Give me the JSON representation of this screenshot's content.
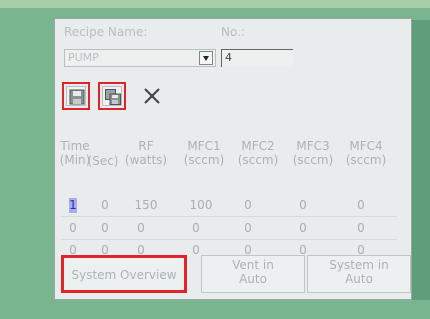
{
  "recipe": {
    "name_label": "Recipe Name:",
    "name_value": "PUMP",
    "no_label": "No.:",
    "no_value": "4"
  },
  "toolbar": {
    "save_icon": "save-icon",
    "save_as_icon": "save-as-icon",
    "close_icon": "close-icon"
  },
  "table": {
    "headers": [
      {
        "top": "Time",
        "bottom": "(Min)"
      },
      {
        "top": "",
        "bottom": "(Sec)"
      },
      {
        "top": "RF",
        "bottom": "(watts)"
      },
      {
        "top": "MFC1",
        "bottom": "(sccm)"
      },
      {
        "top": "MFC2",
        "bottom": "(sccm)"
      },
      {
        "top": "MFC3",
        "bottom": "(sccm)"
      },
      {
        "top": "MFC4",
        "bottom": "(sccm)"
      }
    ],
    "rows": [
      [
        "1",
        "0",
        "150",
        "100",
        "0",
        "0",
        "0"
      ],
      [
        "0",
        "0",
        "0",
        "0",
        "0",
        "0",
        "0"
      ],
      [
        "0",
        "0",
        "0",
        "0",
        "0",
        "0",
        "0"
      ]
    ]
  },
  "buttons": {
    "system_overview": "System Overview",
    "vent_line1": "Vent in",
    "vent_line2": "Auto",
    "system_line1": "System in",
    "system_line2": "Auto"
  },
  "colors": {
    "highlight": "#e0242a",
    "bezel": "#79b690",
    "screen": "#e9ecec"
  }
}
